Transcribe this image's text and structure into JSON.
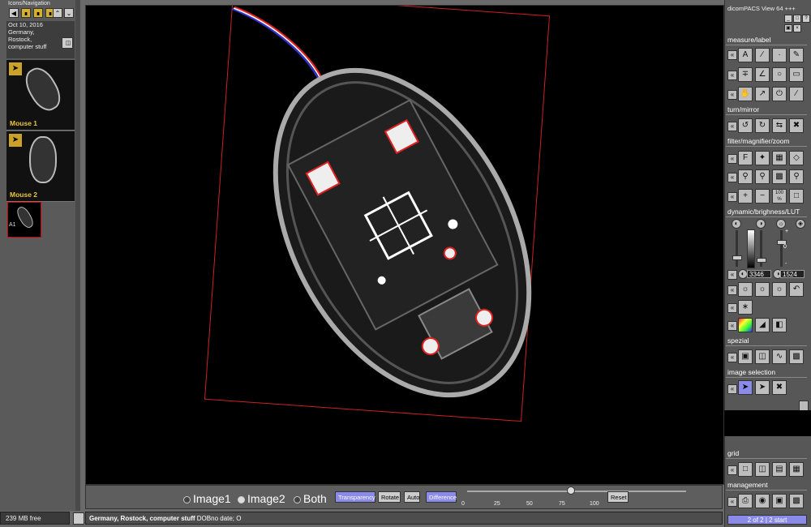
{
  "left_panel": {
    "title": "Icons/Navigation",
    "info": [
      "Oct 10, 2016",
      "Germany,",
      "Rostock,",
      "computer stuff"
    ],
    "thumbnails": [
      {
        "label": "Mouse 1"
      },
      {
        "label": "Mouse 2"
      },
      {
        "label": "A1"
      }
    ],
    "memory": "239 MB free"
  },
  "controls": {
    "options": [
      "Image1",
      "Image2",
      "Both"
    ],
    "selected": "Image2",
    "buttons": [
      "Transparency",
      "Rotate",
      "Auto",
      "Difference",
      "Reset"
    ],
    "ticks": [
      "0",
      "25",
      "50",
      "75",
      "100"
    ],
    "slider_value": 80
  },
  "status": {
    "patient": "Germany, Rostock, computer stuff",
    "extra": "DOBno date; O"
  },
  "right_panel": {
    "title": "dicomPACS View 64 +++",
    "sections": [
      "measure/label",
      "turn/mirror",
      "filter/magnifier/zoom",
      "dynamic/brighness/LUT",
      "spezial",
      "image selection",
      "grid",
      "management"
    ],
    "zoom_label": "100 %",
    "window_level": "3346",
    "window_width": "1524",
    "slider_max": "+",
    "slider_mid": "0",
    "slider_min": "-",
    "page_indicator": "2 of 2 | 2 start"
  },
  "colors": {
    "accent": "#8a8ae8",
    "thumb_label": "#e9c53a",
    "frame_red": "#cc2222"
  }
}
